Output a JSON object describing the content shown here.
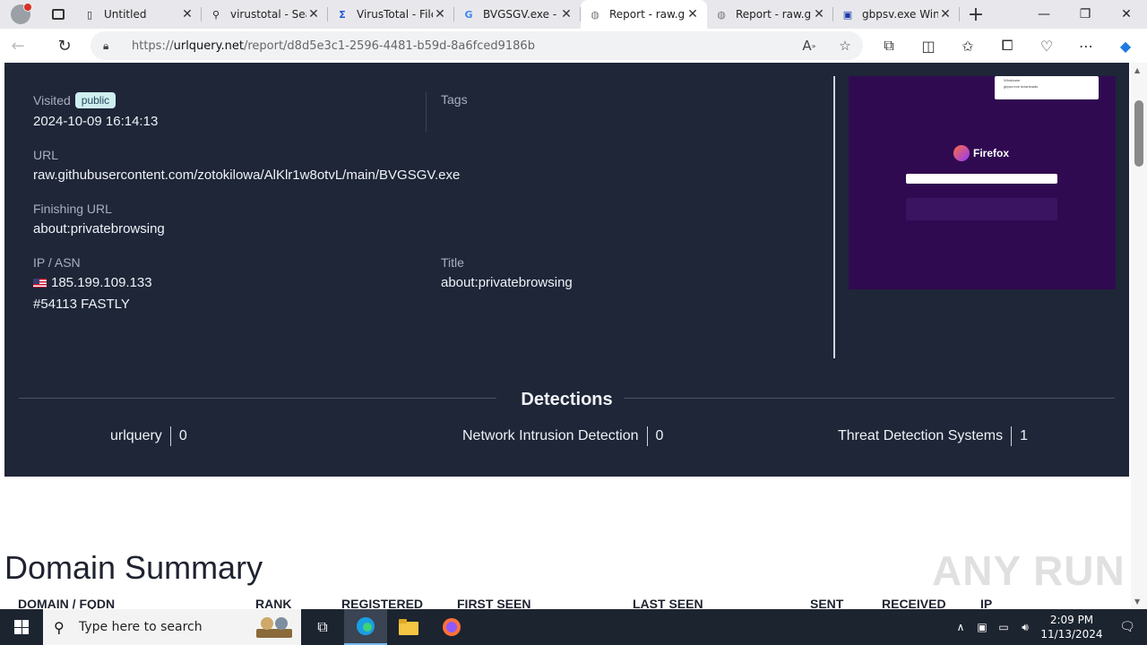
{
  "tabs": [
    {
      "title": "Untitled",
      "favicon": "page-icon",
      "active": false
    },
    {
      "title": "virustotal - Search",
      "favicon": "search-icon",
      "active": false
    },
    {
      "title": "VirusTotal - File",
      "favicon": "virustotal-icon",
      "active": false
    },
    {
      "title": "BVGSGV.exe - Google",
      "favicon": "google-icon",
      "active": false
    },
    {
      "title": "Report - raw.githubusercontent.com",
      "favicon": "urlquery-icon",
      "active": true
    },
    {
      "title": "Report - raw.githubusercontent.com",
      "favicon": "urlquery-icon",
      "active": false
    },
    {
      "title": "gbpsv.exe Windows",
      "favicon": "site-icon",
      "active": false
    }
  ],
  "address": {
    "scheme": "https://",
    "host": "urlquery.net",
    "path": "/report/d8d5e3c1-2596-4481-b59d-8a6fced9186b"
  },
  "report": {
    "visited_label": "Visited",
    "visibility_badge": "public",
    "visited_date": "2024-10-09 16:14:13",
    "tags_label": "Tags",
    "url_label": "URL",
    "url_value": "raw.githubusercontent.com/zotokilowa/AlKlr1w8otvL/main/BVGSGV.exe",
    "finishing_label": "Finishing URL",
    "finishing_value": "about:privatebrowsing",
    "ip_label": "IP / ASN",
    "ip_value": "185.199.109.133",
    "asn_value": "#54113 FASTLY",
    "title_label": "Title",
    "title_value": "about:privatebrowsing",
    "screenshot": {
      "brand": "Firefox",
      "popup_title": "Windowse",
      "popup_sub": "gbpsv.exe downloads"
    }
  },
  "detections": {
    "heading": "Detections",
    "items": [
      {
        "name": "urlquery",
        "count": "0"
      },
      {
        "name": "Network Intrusion Detection",
        "count": "0"
      },
      {
        "name": "Threat Detection Systems",
        "count": "1"
      }
    ]
  },
  "domain_summary": {
    "heading": "Domain Summary",
    "columns": [
      "DOMAIN / FQDN",
      "RANK",
      "REGISTERED",
      "FIRST SEEN",
      "LAST SEEN",
      "SENT",
      "RECEIVED",
      "IP"
    ]
  },
  "watermark": "ANY RUN",
  "taskbar": {
    "search_placeholder": "Type here to search",
    "time": "2:09 PM",
    "date": "11/13/2024"
  }
}
